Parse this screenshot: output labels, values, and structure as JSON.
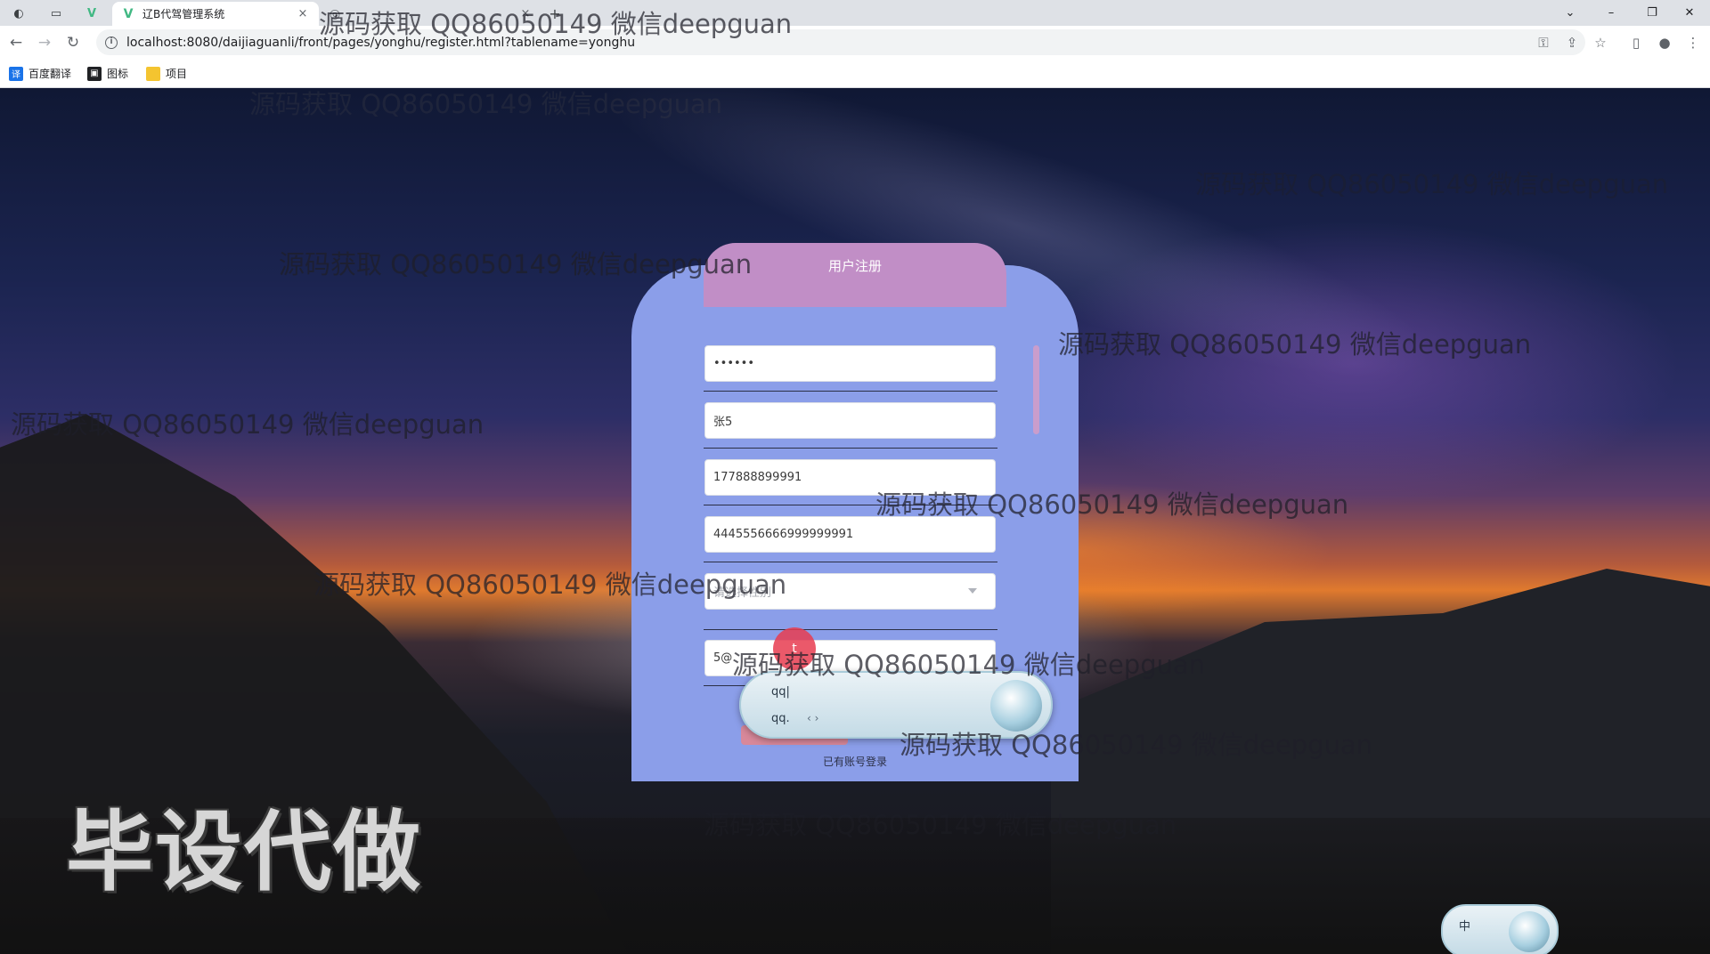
{
  "browser": {
    "tabs": [
      {
        "title": "辽B代驾管理系统",
        "close": "×",
        "active": true
      },
      {
        "title": "",
        "close": "×",
        "active": false
      }
    ],
    "new_tab": "+",
    "url": "localhost:8080/daijiaguanli/front/pages/yonghu/register.html?tablename=yonghu",
    "bookmarks": [
      {
        "label": "百度翻译",
        "icon": "translate-icon",
        "color": "#1a73e8"
      },
      {
        "label": "图标",
        "icon": "image-icon",
        "color": "#202124"
      },
      {
        "label": "项目",
        "icon": "folder-icon",
        "color": "#f4c430"
      }
    ]
  },
  "form": {
    "title": "用户注册",
    "fields": [
      {
        "name": "password",
        "value": "••••••"
      },
      {
        "name": "name",
        "value": "张5"
      },
      {
        "name": "phone",
        "value": "177888899991"
      },
      {
        "name": "id-number",
        "value": "4445556666999999991"
      },
      {
        "name": "gender",
        "placeholder": "请选择性别"
      },
      {
        "name": "email",
        "value": "5@"
      }
    ],
    "login_link": "已有账号登录"
  },
  "ime": {
    "composition": "qq|",
    "candidate": "qq.",
    "arrows": "‹ ›",
    "mode": "中"
  },
  "cursor_label": "t",
  "overlay_text": "毕设代做",
  "watermark": "源码获取 QQ86050149 微信deepguan"
}
